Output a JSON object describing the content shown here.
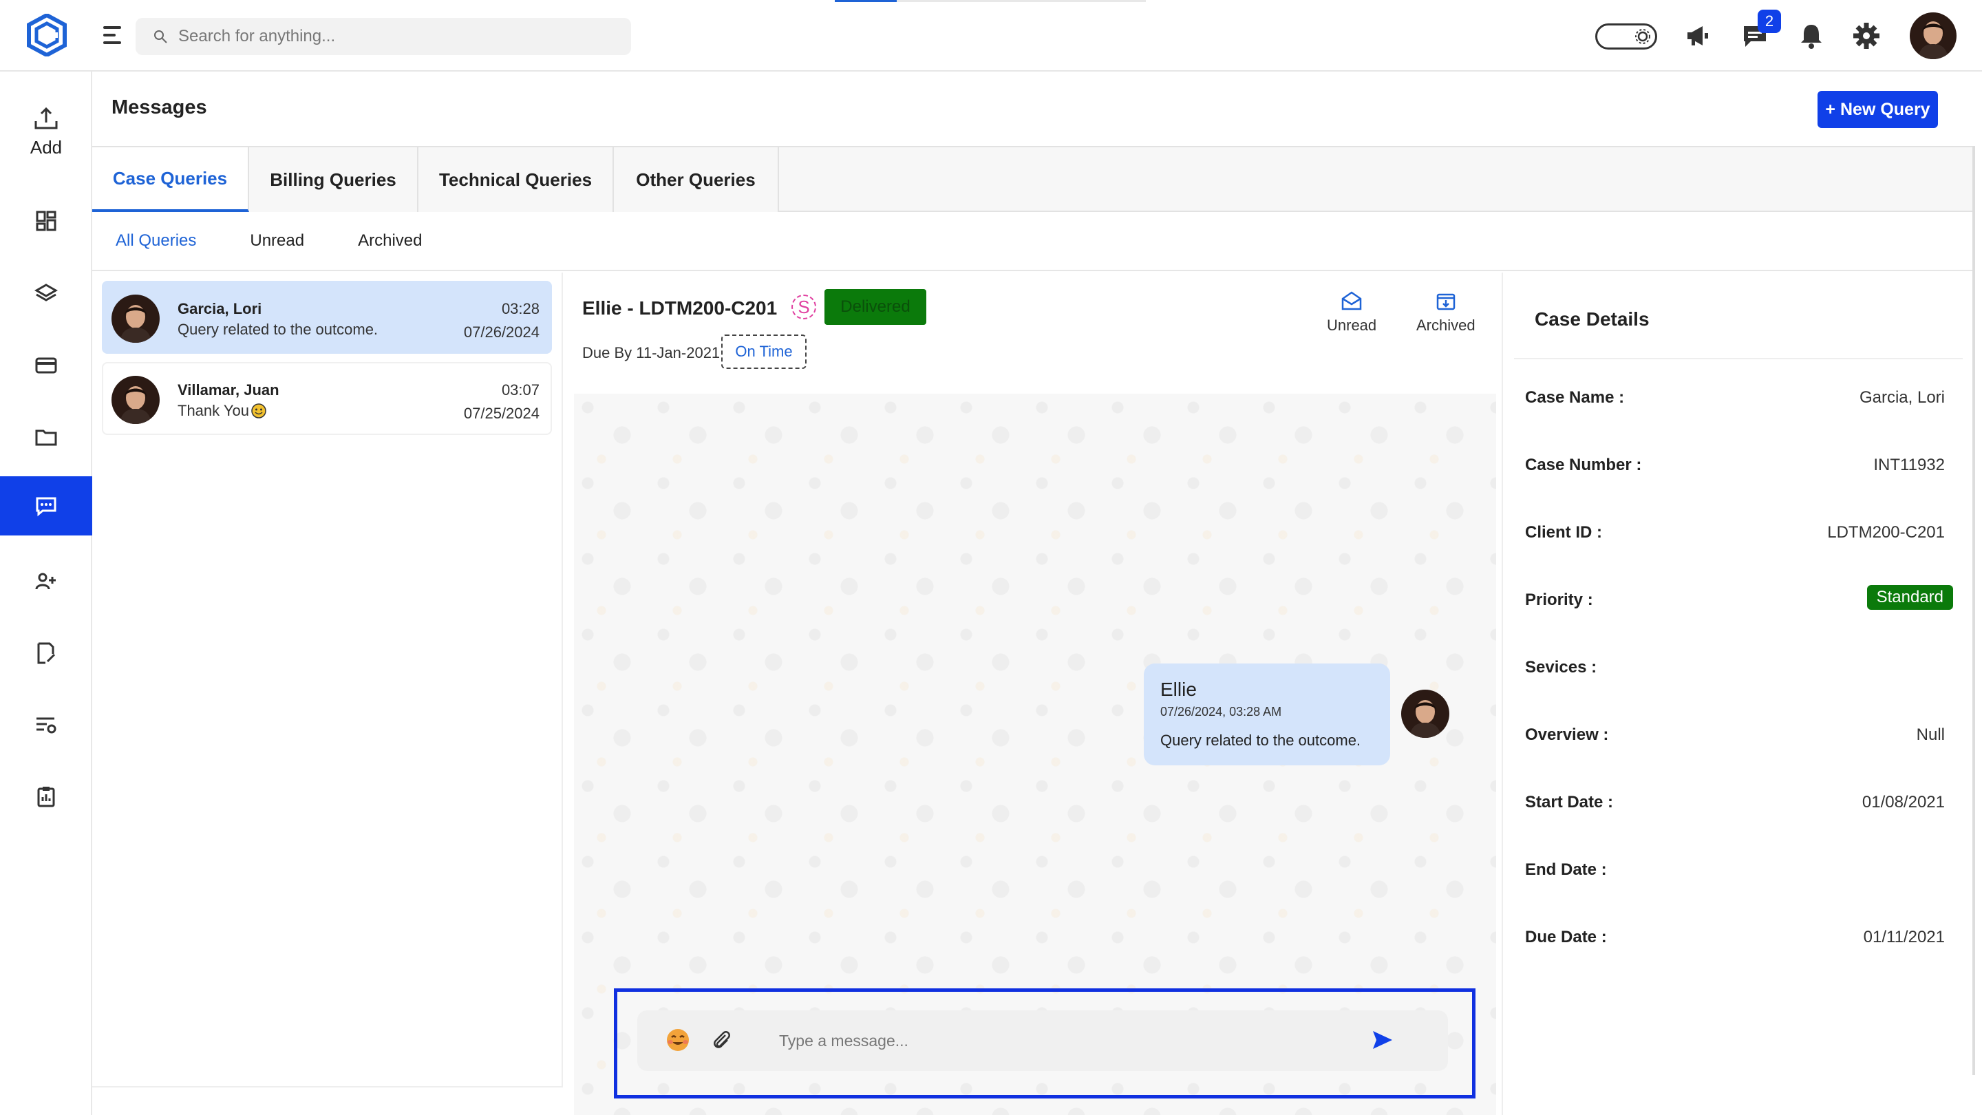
{
  "topbar": {
    "search_placeholder": "Search for anything...",
    "messages_badge": "2"
  },
  "sidebar": {
    "add_label": "Add",
    "items": [
      "dashboard-icon",
      "layers-icon",
      "card-icon",
      "folder-icon",
      "messages-icon",
      "users-icon",
      "edit-document-icon",
      "list-settings-icon",
      "clipboard-icon"
    ],
    "active": "messages-icon"
  },
  "header": {
    "title": "Messages",
    "new_query_label": "+ New Query"
  },
  "tabs": [
    {
      "label": "Case Queries",
      "active": true
    },
    {
      "label": "Billing Queries",
      "active": false
    },
    {
      "label": "Technical Queries",
      "active": false
    },
    {
      "label": "Other Queries",
      "active": false
    }
  ],
  "subtabs": [
    {
      "label": "All Queries",
      "active": true
    },
    {
      "label": "Unread",
      "active": false
    },
    {
      "label": "Archived",
      "active": false
    }
  ],
  "conversations": [
    {
      "name": "Garcia, Lori",
      "message": "Query related to the outcome.",
      "time": "03:28",
      "date": "07/26/2024",
      "active": true
    },
    {
      "name": "Villamar, Juan",
      "message": "Thank You",
      "time": "03:07",
      "date": "07/25/2024",
      "active": false
    }
  ],
  "chat": {
    "title": "Ellie - LDTM200-C201",
    "s_icon": "S",
    "status": "Delivered",
    "due": "Due By 11-Jan-2021",
    "due_status": "On Time",
    "actions": {
      "unread": "Unread",
      "archived": "Archived"
    },
    "message": {
      "sender": "Ellie",
      "timestamp": "07/26/2024, 03:28 AM",
      "text": "Query related to the outcome."
    },
    "composer_placeholder": "Type a message..."
  },
  "details": {
    "title": "Case Details",
    "rows": [
      {
        "label": "Case Name :",
        "value": "Garcia, Lori"
      },
      {
        "label": "Case Number :",
        "value": "INT11932"
      },
      {
        "label": "Client ID :",
        "value": "LDTM200-C201"
      },
      {
        "label": "Priority :",
        "value": "Standard"
      },
      {
        "label": "Sevices :",
        "value": ""
      },
      {
        "label": "Overview :",
        "value": "Null"
      },
      {
        "label": "Start Date :",
        "value": "01/08/2021"
      },
      {
        "label": "End Date :",
        "value": ""
      },
      {
        "label": "Due Date :",
        "value": "01/11/2021"
      }
    ]
  },
  "colors": {
    "accent": "#1040e8",
    "link": "#1e63d6",
    "success": "#0b7a0b",
    "bubble": "#d4e4fb"
  }
}
